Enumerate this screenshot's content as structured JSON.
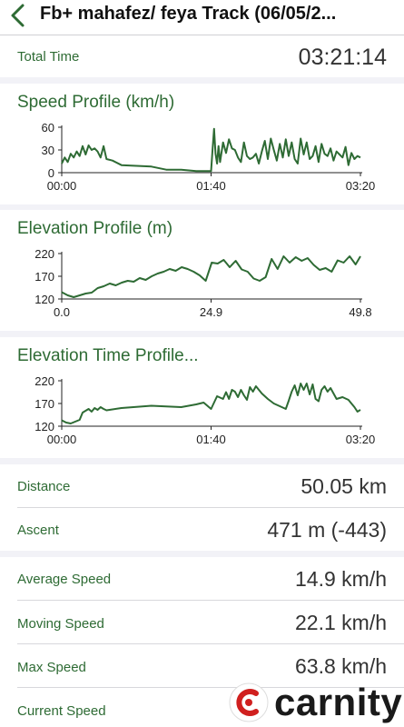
{
  "nav": {
    "back_icon": "chevron-left-icon",
    "title": "Fb+ mahafez/ feya Track (06/05/2..."
  },
  "total_time": {
    "label": "Total Time",
    "value": "03:21:14"
  },
  "charts": [
    {
      "type": "line",
      "title": "Speed Profile (km/h)",
      "x_tick_labels": [
        "00:00",
        "01:40",
        "03:20"
      ],
      "y_ticks": [
        0,
        30,
        60
      ],
      "y_tick_labels": [
        "0",
        "30",
        "60"
      ],
      "ylim": [
        0,
        60
      ],
      "xlim": [
        0,
        200
      ],
      "color": "#2e6b34",
      "x": [
        0,
        2,
        4,
        6,
        8,
        10,
        12,
        14,
        16,
        18,
        20,
        22,
        24,
        26,
        28,
        30,
        34,
        40,
        60,
        70,
        80,
        90,
        100,
        101,
        102,
        103,
        104,
        105,
        106,
        108,
        110,
        112,
        114,
        116,
        118,
        120,
        122,
        124,
        126,
        128,
        130,
        132,
        134,
        136,
        138,
        140,
        142,
        144,
        146,
        148,
        150,
        152,
        154,
        156,
        158,
        160,
        162,
        164,
        166,
        168,
        170,
        172,
        174,
        176,
        178,
        180,
        182,
        184,
        186,
        188,
        190,
        192,
        194,
        196,
        198,
        200
      ],
      "y": [
        12,
        20,
        14,
        25,
        20,
        28,
        22,
        35,
        24,
        36,
        30,
        32,
        28,
        20,
        35,
        18,
        16,
        10,
        8,
        4,
        4,
        2,
        2,
        30,
        58,
        25,
        12,
        35,
        14,
        40,
        26,
        44,
        32,
        30,
        20,
        14,
        40,
        22,
        18,
        20,
        25,
        12,
        28,
        42,
        18,
        45,
        30,
        16,
        38,
        20,
        44,
        22,
        40,
        18,
        12,
        45,
        24,
        40,
        18,
        22,
        35,
        14,
        38,
        25,
        22,
        32,
        16,
        28,
        24,
        20,
        34,
        10,
        26,
        18,
        22,
        20
      ]
    },
    {
      "type": "line",
      "title": "Elevation Profile (m)",
      "x_tick_labels": [
        "0.0",
        "24.9",
        "49.8"
      ],
      "y_ticks": [
        120,
        170,
        220
      ],
      "y_tick_labels": [
        "120",
        "170",
        "220"
      ],
      "ylim": [
        120,
        220
      ],
      "xlim": [
        0,
        49.8
      ],
      "color": "#2e6b34",
      "x": [
        0,
        1,
        2,
        3,
        4,
        5,
        6,
        7,
        8,
        9,
        10,
        11,
        12,
        13,
        14,
        15,
        16,
        17,
        18,
        19,
        20,
        21,
        22,
        23,
        24,
        25,
        26,
        27,
        28,
        29,
        30,
        31,
        32,
        33,
        34,
        35,
        36,
        37,
        38,
        39,
        40,
        41,
        42,
        43,
        44,
        45,
        46,
        47,
        48,
        49,
        49.8
      ],
      "y": [
        135,
        128,
        124,
        128,
        132,
        134,
        144,
        148,
        154,
        150,
        156,
        160,
        158,
        166,
        162,
        170,
        176,
        180,
        186,
        182,
        190,
        186,
        180,
        172,
        160,
        200,
        198,
        206,
        190,
        204,
        185,
        180,
        165,
        160,
        168,
        208,
        186,
        214,
        200,
        212,
        204,
        210,
        195,
        184,
        188,
        180,
        205,
        200,
        214,
        196,
        214,
        206,
        192,
        180,
        190,
        182,
        176,
        165,
        155,
        152,
        150
      ]
    },
    {
      "type": "line",
      "title": "Elevation Time Profile...",
      "x_tick_labels": [
        "00:00",
        "01:40",
        "03:20"
      ],
      "y_ticks": [
        120,
        170,
        220
      ],
      "y_tick_labels": [
        "120",
        "170",
        "220"
      ],
      "ylim": [
        120,
        220
      ],
      "xlim": [
        0,
        200
      ],
      "color": "#2e6b34",
      "x": [
        0,
        3,
        6,
        9,
        12,
        14,
        16,
        18,
        20,
        22,
        24,
        26,
        28,
        30,
        40,
        60,
        80,
        90,
        95,
        100,
        104,
        108,
        110,
        112,
        114,
        116,
        118,
        120,
        122,
        124,
        126,
        128,
        130,
        134,
        138,
        142,
        146,
        150,
        152,
        154,
        156,
        158,
        160,
        162,
        164,
        166,
        168,
        170,
        172,
        174,
        176,
        178,
        180,
        184,
        188,
        192,
        196,
        198,
        200
      ],
      "y": [
        133,
        128,
        126,
        130,
        134,
        150,
        154,
        158,
        152,
        160,
        156,
        162,
        158,
        155,
        160,
        165,
        162,
        168,
        172,
        158,
        186,
        180,
        195,
        180,
        200,
        196,
        184,
        200,
        188,
        178,
        206,
        196,
        208,
        192,
        180,
        170,
        164,
        158,
        176,
        196,
        210,
        188,
        214,
        200,
        214,
        190,
        212,
        180,
        175,
        200,
        208,
        196,
        204,
        180,
        184,
        178,
        162,
        152,
        156
      ]
    }
  ],
  "stats": [
    {
      "label": "Distance",
      "value": "50.05 km"
    },
    {
      "label": "Ascent",
      "value": "471 m (-443)"
    },
    {
      "label": "Average Speed",
      "value": "14.9 km/h"
    },
    {
      "label": "Moving Speed",
      "value": "22.1 km/h"
    },
    {
      "label": "Max Speed",
      "value": "63.8 km/h"
    },
    {
      "label": "Current Speed",
      "value": ""
    }
  ],
  "watermark": {
    "text": "carnity",
    "icon": "carnity-logo-icon"
  }
}
